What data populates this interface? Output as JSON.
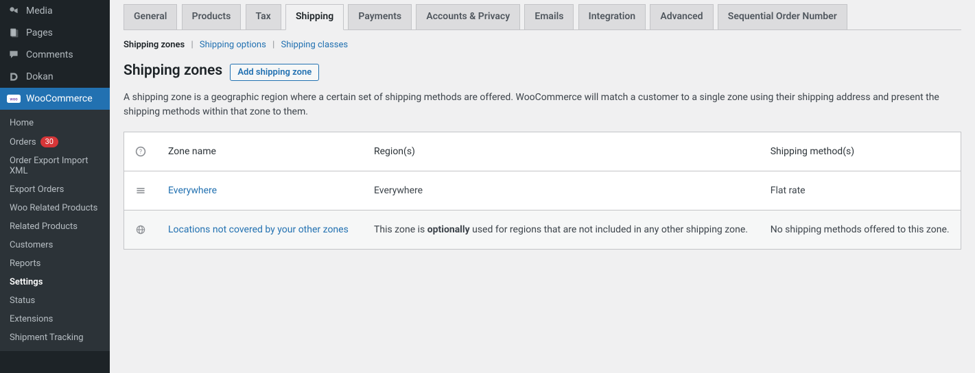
{
  "sidebar": {
    "top_items": [
      {
        "icon": "media",
        "label": "Media"
      },
      {
        "icon": "page",
        "label": "Pages"
      },
      {
        "icon": "comment",
        "label": "Comments"
      },
      {
        "icon": "dokan",
        "label": "Dokan"
      }
    ],
    "active": {
      "icon": "woo",
      "label": "WooCommerce"
    },
    "submenu": [
      {
        "label": "Home",
        "current": false
      },
      {
        "label": "Orders",
        "badge": "30",
        "current": false
      },
      {
        "label": "Order Export Import XML",
        "current": false
      },
      {
        "label": "Export Orders",
        "current": false
      },
      {
        "label": "Woo Related Products",
        "current": false
      },
      {
        "label": "Related Products",
        "current": false
      },
      {
        "label": "Customers",
        "current": false
      },
      {
        "label": "Reports",
        "current": false
      },
      {
        "label": "Settings",
        "current": true
      },
      {
        "label": "Status",
        "current": false
      },
      {
        "label": "Extensions",
        "current": false
      },
      {
        "label": "Shipment Tracking",
        "current": false
      }
    ]
  },
  "tabs": [
    {
      "label": "General",
      "active": false
    },
    {
      "label": "Products",
      "active": false
    },
    {
      "label": "Tax",
      "active": false
    },
    {
      "label": "Shipping",
      "active": true
    },
    {
      "label": "Payments",
      "active": false
    },
    {
      "label": "Accounts & Privacy",
      "active": false
    },
    {
      "label": "Emails",
      "active": false
    },
    {
      "label": "Integration",
      "active": false
    },
    {
      "label": "Advanced",
      "active": false
    },
    {
      "label": "Sequential Order Number",
      "active": false
    }
  ],
  "subnav": {
    "zones": "Shipping zones",
    "options": "Shipping options",
    "classes": "Shipping classes"
  },
  "heading": "Shipping zones",
  "add_button": "Add shipping zone",
  "description": "A shipping zone is a geographic region where a certain set of shipping methods are offered. WooCommerce will match a customer to a single zone using their shipping address and present the shipping methods within that zone to them.",
  "table": {
    "columns": {
      "name": "Zone name",
      "region": "Region(s)",
      "method": "Shipping method(s)"
    },
    "rows": [
      {
        "icon": "drag",
        "name": "Everywhere",
        "region_plain": "Everywhere",
        "method": "Flat rate"
      },
      {
        "icon": "globe",
        "name": "Locations not covered by your other zones",
        "region_pre": "This zone is ",
        "region_strong": "optionally",
        "region_post": " used for regions that are not included in any other shipping zone.",
        "method": "No shipping methods offered to this zone."
      }
    ]
  }
}
